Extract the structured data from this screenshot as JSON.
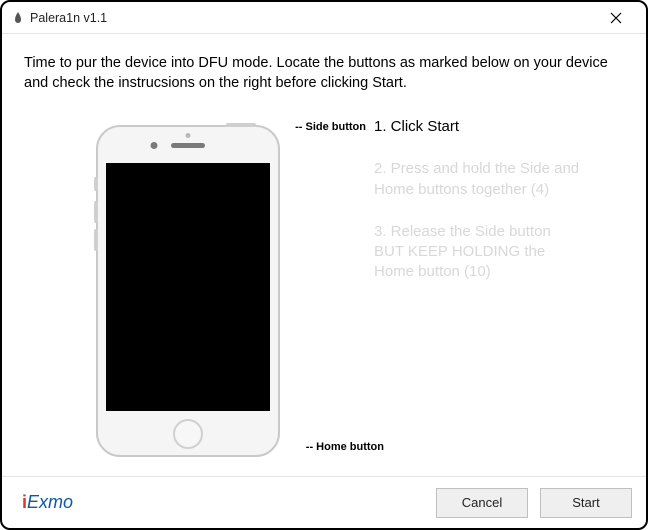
{
  "window": {
    "title": "Palera1n v1.1"
  },
  "description": "Time to pur the device into DFU mode. Locate the buttons as marked below on your device  and check the instrucsions on the right before clicking Start.",
  "device_labels": {
    "side": "-- Side button",
    "home": "-- Home button"
  },
  "steps": [
    {
      "text": "1. Click Start",
      "active": true
    },
    {
      "text": "2. Press and hold the Side and Home buttons together (4)",
      "active": false
    },
    {
      "text": "3. Release the Side button BUT KEEP HOLDING the Home button (10)",
      "active": false
    }
  ],
  "buttons": {
    "cancel": "Cancel",
    "start": "Start"
  },
  "brand": {
    "prefix": "i",
    "rest": "Exmo"
  }
}
